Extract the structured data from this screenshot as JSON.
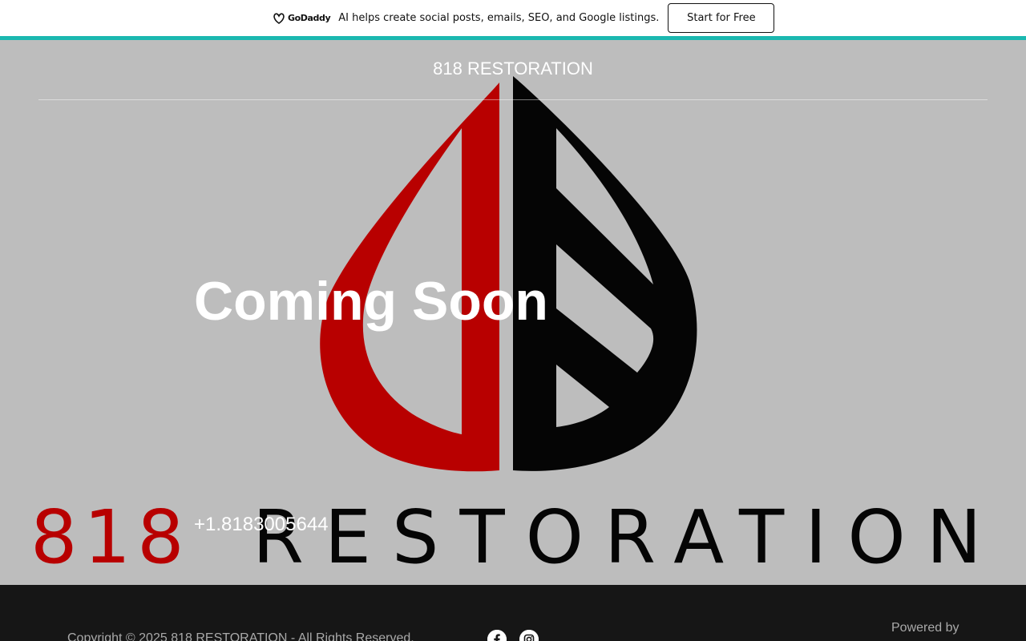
{
  "promo": {
    "logo_text": "GoDaddy",
    "message": "AI helps create social posts, emails, SEO, and Google listings.",
    "cta_label": "Start for Free",
    "accent_color": "#1bb8b0"
  },
  "header": {
    "site_title": "818 RESTORATION"
  },
  "hero": {
    "headline": "Coming Soon",
    "phone": "+1.8183005644",
    "background_color": "#bdbdbd",
    "logo": {
      "wordmark_number": "818",
      "wordmark_text": "RESTORATION",
      "red": "#b80000",
      "black": "#050505"
    }
  },
  "footer": {
    "copyright": "Copyright © 2025 818 RESTORATION - All Rights Reserved.",
    "social_icons": [
      "facebook-icon",
      "instagram-icon"
    ],
    "powered_by": "Powered by",
    "background_color": "#161616"
  }
}
